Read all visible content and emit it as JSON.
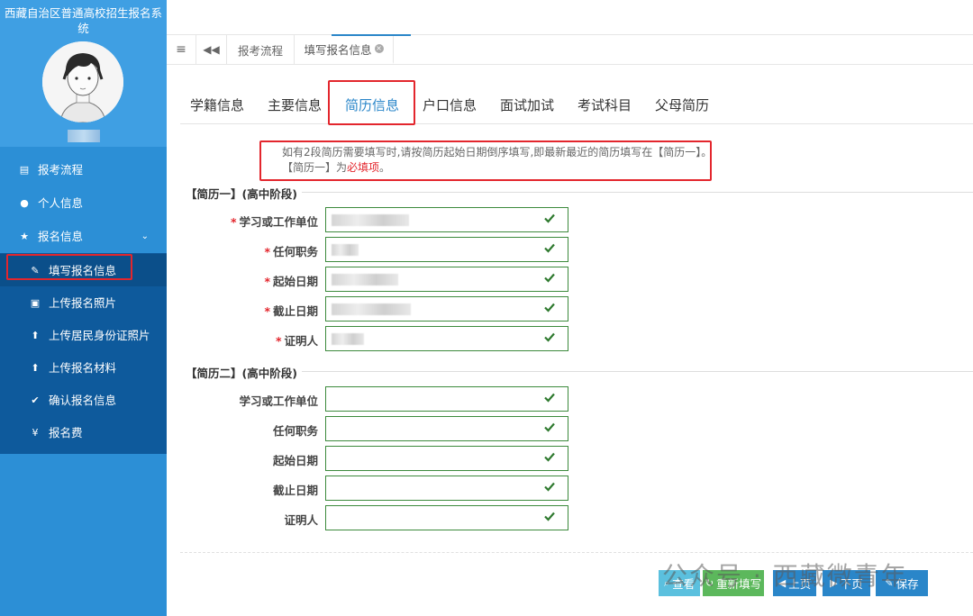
{
  "app": {
    "title": "西藏自治区普通高校招生报名系统"
  },
  "sidebar": {
    "menu": [
      {
        "label": "报考流程",
        "icon": "card-icon"
      },
      {
        "label": "个人信息",
        "icon": "user-icon"
      },
      {
        "label": "报名信息",
        "icon": "star-icon"
      }
    ],
    "submenu": [
      {
        "label": "填写报名信息",
        "icon": "edit-icon"
      },
      {
        "label": "上传报名照片",
        "icon": "image-icon"
      },
      {
        "label": "上传居民身份证照片",
        "icon": "upload-circle-icon"
      },
      {
        "label": "上传报名材料",
        "icon": "upload-circle-icon"
      },
      {
        "label": "确认报名信息",
        "icon": "check-icon"
      }
    ],
    "fee": {
      "label": "报名费",
      "icon": "yen-icon"
    }
  },
  "topbar": {
    "tabs": [
      {
        "label": "报考流程"
      },
      {
        "label": "填写报名信息"
      }
    ]
  },
  "subtabs": [
    "学籍信息",
    "主要信息",
    "简历信息",
    "户口信息",
    "面试加试",
    "考试科目",
    "父母简历"
  ],
  "notice": {
    "line1": "如有2段简历需要填写时,请按简历起始日期倒序填写,即最新最近的简历填写在【简历一】。",
    "line2_prefix": "【简历一】为",
    "line2_required": "必填项",
    "line2_suffix": "。"
  },
  "resume1": {
    "title": "【简历一】(高中阶段)",
    "fields": [
      {
        "label": "学习或工作单位",
        "required": "*"
      },
      {
        "label": "任何职务",
        "required": "*"
      },
      {
        "label": "起始日期",
        "required": "*"
      },
      {
        "label": "截止日期",
        "required": "*"
      },
      {
        "label": "证明人",
        "required": "*"
      }
    ]
  },
  "resume2": {
    "title": "【简历二】(高中阶段)",
    "fields": [
      {
        "label": "学习或工作单位"
      },
      {
        "label": "任何职务"
      },
      {
        "label": "起始日期"
      },
      {
        "label": "截止日期"
      },
      {
        "label": "证明人"
      }
    ]
  },
  "buttons": [
    {
      "label": "查看",
      "color": "#5bc0de"
    },
    {
      "label": "重新填写",
      "color": "#5cb85c"
    },
    {
      "label": "上页",
      "color": "#2a86c9"
    },
    {
      "label": "下页",
      "color": "#2a86c9"
    },
    {
      "label": "保存",
      "color": "#2a86c9"
    }
  ],
  "watermark": "公众号 · 西藏微青年",
  "colors": {
    "sidebar": "#2c8fd6",
    "submenu": "#0e5a9c",
    "accent": "#2a86c9",
    "input_border": "#3c8a3c",
    "highlight": "#e3262d"
  }
}
